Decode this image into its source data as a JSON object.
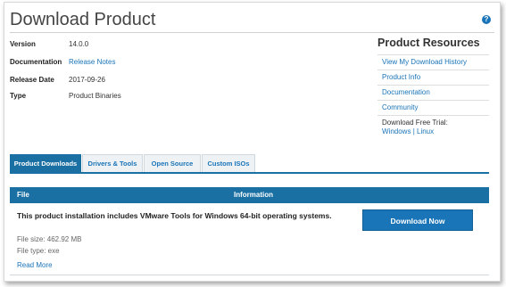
{
  "page": {
    "title": "Download Product"
  },
  "meta": {
    "version": {
      "label": "Version",
      "value": "14.0.0"
    },
    "documentation": {
      "label": "Documentation",
      "value": "Release Notes"
    },
    "release_date": {
      "label": "Release Date",
      "value": "2017-09-26"
    },
    "type": {
      "label": "Type",
      "value": "Product Binaries"
    }
  },
  "resources": {
    "title": "Product Resources",
    "items": [
      "View My Download History",
      "Product Info",
      "Documentation",
      "Community"
    ],
    "trial_label": "Download Free Trial:",
    "trial_windows": "Windows",
    "trial_sep": "|",
    "trial_linux": "Linux"
  },
  "tabs": [
    "Product Downloads",
    "Drivers & Tools",
    "Open Source",
    "Custom ISOs"
  ],
  "table": {
    "headers": {
      "file": "File",
      "information": "Information"
    },
    "description": "This product installation includes VMware Tools for Windows 64-bit operating systems.",
    "file_size": "File size: 462.92 MB",
    "file_type": "File type: exe",
    "download_button": "Download Now",
    "read_more": "Read More"
  },
  "colors": {
    "accent": "#1a6fa3",
    "link": "#1a74b8"
  },
  "icons": {
    "help": "help-icon"
  }
}
